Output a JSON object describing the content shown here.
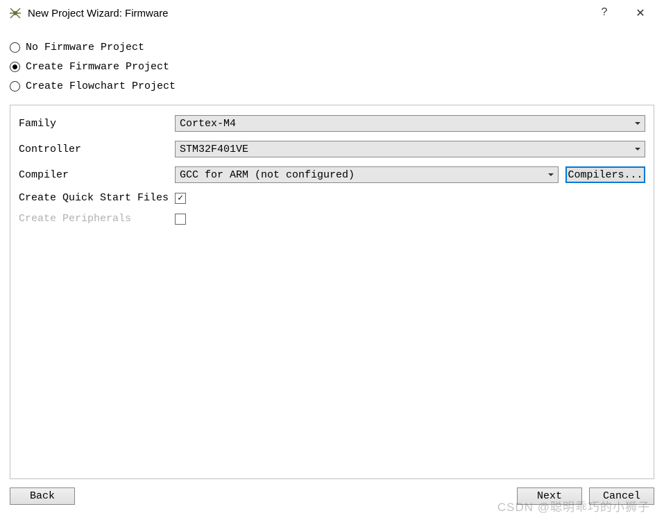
{
  "titlebar": {
    "title": "New Project Wizard: Firmware",
    "help": "?",
    "close": "✕"
  },
  "radio_options": {
    "no_firmware": "No Firmware Project",
    "create_firmware": "Create Firmware Project",
    "create_flowchart": "Create Flowchart Project",
    "selected": "create_firmware"
  },
  "form": {
    "family_label": "Family",
    "family_value": "Cortex-M4",
    "controller_label": "Controller",
    "controller_value": "STM32F401VE",
    "compiler_label": "Compiler",
    "compiler_value": "GCC for ARM (not configured)",
    "compilers_button": "Compilers...",
    "quickstart_label": "Create Quick Start Files",
    "quickstart_checked": true,
    "peripherals_label": "Create Peripherals",
    "peripherals_checked": false
  },
  "buttons": {
    "back": "Back",
    "next": "Next",
    "cancel": "Cancel"
  },
  "watermark": "CSDN @聪明乖巧的小狮子"
}
